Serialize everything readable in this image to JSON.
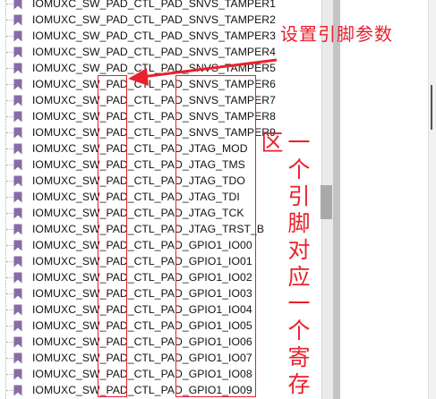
{
  "tree": {
    "items": [
      {
        "label": "IOMUXC_SW_PAD_CTL_PAD_SNVS_TAMPER1"
      },
      {
        "label": "IOMUXC_SW_PAD_CTL_PAD_SNVS_TAMPER2"
      },
      {
        "label": "IOMUXC_SW_PAD_CTL_PAD_SNVS_TAMPER3"
      },
      {
        "label": "IOMUXC_SW_PAD_CTL_PAD_SNVS_TAMPER4"
      },
      {
        "label": "IOMUXC_SW_PAD_CTL_PAD_SNVS_TAMPER5"
      },
      {
        "label": "IOMUXC_SW_PAD_CTL_PAD_SNVS_TAMPER6"
      },
      {
        "label": "IOMUXC_SW_PAD_CTL_PAD_SNVS_TAMPER7"
      },
      {
        "label": "IOMUXC_SW_PAD_CTL_PAD_SNVS_TAMPER8"
      },
      {
        "label": "IOMUXC_SW_PAD_CTL_PAD_SNVS_TAMPER9"
      },
      {
        "label": "IOMUXC_SW_PAD_CTL_PAD_JTAG_MOD"
      },
      {
        "label": "IOMUXC_SW_PAD_CTL_PAD_JTAG_TMS"
      },
      {
        "label": "IOMUXC_SW_PAD_CTL_PAD_JTAG_TDO"
      },
      {
        "label": "IOMUXC_SW_PAD_CTL_PAD_JTAG_TDI"
      },
      {
        "label": "IOMUXC_SW_PAD_CTL_PAD_JTAG_TCK"
      },
      {
        "label": "IOMUXC_SW_PAD_CTL_PAD_JTAG_TRST_B"
      },
      {
        "label": "IOMUXC_SW_PAD_CTL_PAD_GPIO1_IO00"
      },
      {
        "label": "IOMUXC_SW_PAD_CTL_PAD_GPIO1_IO01"
      },
      {
        "label": "IOMUXC_SW_PAD_CTL_PAD_GPIO1_IO02"
      },
      {
        "label": "IOMUXC_SW_PAD_CTL_PAD_GPIO1_IO03"
      },
      {
        "label": "IOMUXC_SW_PAD_CTL_PAD_GPIO1_IO04"
      },
      {
        "label": "IOMUXC_SW_PAD_CTL_PAD_GPIO1_IO05"
      },
      {
        "label": "IOMUXC_SW_PAD_CTL_PAD_GPIO1_IO06"
      },
      {
        "label": "IOMUXC_SW_PAD_CTL_PAD_GPIO1_IO07"
      },
      {
        "label": "IOMUXC_SW_PAD_CTL_PAD_GPIO1_IO08"
      },
      {
        "label": "IOMUXC_SW_PAD_CTL_PAD_GPIO1_IO09"
      }
    ],
    "item_icon": "bookmark-icon",
    "icon_color": "#8a6aa8"
  },
  "annotations": {
    "arrow_note": "设置引脚参数",
    "side_note": "一个引脚对应一个寄存区",
    "color": "#e8212c"
  }
}
